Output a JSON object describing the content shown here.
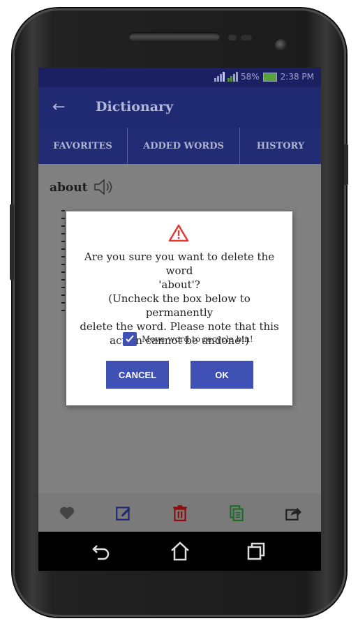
{
  "status": {
    "battery": "58%",
    "time": "2:38 PM"
  },
  "toolbar": {
    "title": "Dictionary"
  },
  "tabs": [
    "FAVORITES",
    "ADDED WORDS",
    "HISTORY"
  ],
  "entry": {
    "word": "about"
  },
  "dialog": {
    "message_line1": "Are you sure you want to delete the word",
    "message_line2": "'about'?",
    "message_line3": "(Uncheck the box below to permanently",
    "message_line4": "delete the word. Please note that this",
    "message_line5": "action cannot be undone!)",
    "checkbox_label": "Move word to recycle bin!",
    "checkbox_checked": true,
    "cancel_label": "CANCEL",
    "ok_label": "OK",
    "button_color": "#3f51b5",
    "warning_color": "#e53935"
  },
  "bottom_actions": [
    "heart-icon",
    "edit-icon",
    "delete-icon",
    "copy-icon",
    "share-icon"
  ],
  "colors": {
    "appbar": "#1f2a72",
    "statusbar": "#1a2061"
  }
}
